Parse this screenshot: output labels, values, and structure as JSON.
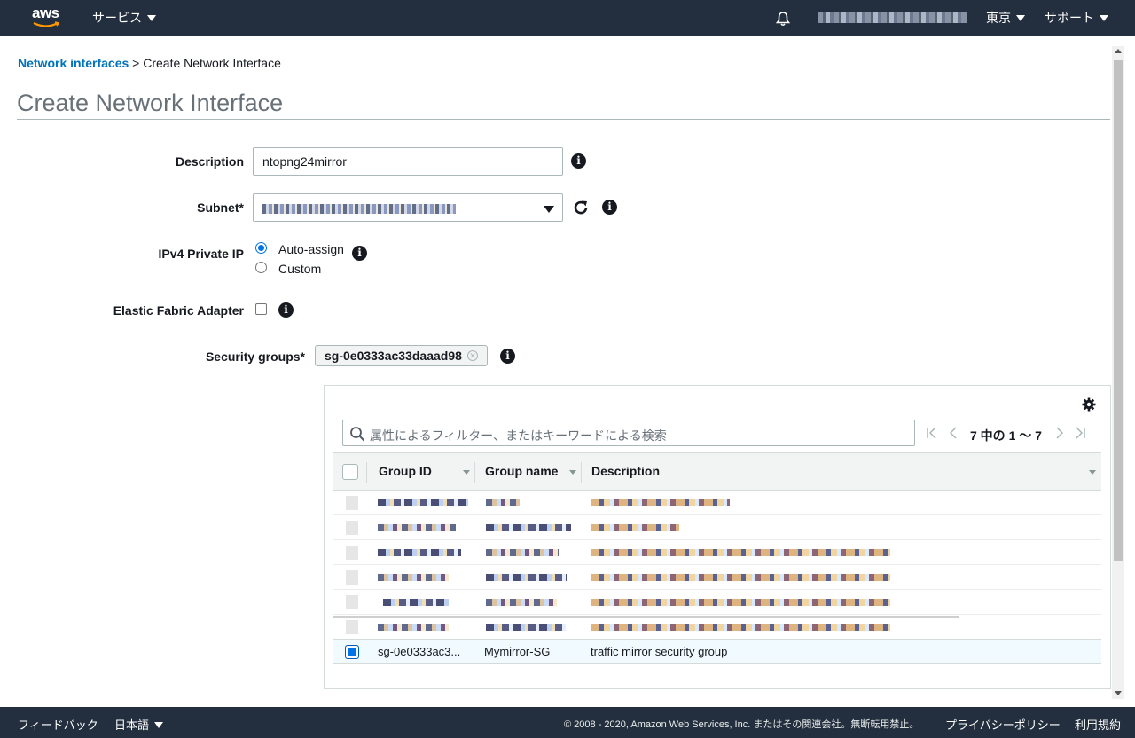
{
  "nav": {
    "logo_text": "aws",
    "services": "サービス",
    "region": "東京",
    "support": "サポート",
    "notifications_icon": "bell-icon"
  },
  "breadcrumb": {
    "parent": "Network interfaces",
    "separator": ">",
    "current": "Create Network Interface"
  },
  "page_title": "Create Network Interface",
  "form": {
    "description_label": "Description",
    "description_value": "ntopng24mirror",
    "subnet_label": "Subnet*",
    "ipv4_label": "IPv4 Private IP",
    "ipv4_options": [
      "Auto-assign",
      "Custom"
    ],
    "ipv4_selected": "Auto-assign",
    "efa_label": "Elastic Fabric Adapter",
    "sg_label": "Security groups*",
    "sg_token": "sg-0e0333ac33daaad98"
  },
  "table": {
    "filter_placeholder": "属性によるフィルター、またはキーワードによる検索",
    "pagination": "7 中の 1 ～ 7",
    "columns": [
      "Group ID",
      "Group name",
      "Description"
    ],
    "selected_row": {
      "group_id": "sg-0e0333ac3...",
      "group_name": "Mymirror-SG",
      "description": "traffic mirror security group"
    }
  },
  "footer": {
    "feedback": "フィードバック",
    "language": "日本語",
    "copyright": "© 2008 - 2020, Amazon Web Services, Inc. またはその関連会社。無断転用禁止。",
    "privacy": "プライバシーポリシー",
    "terms": "利用規約"
  },
  "colors": {
    "nav_bg": "#232f3e",
    "link": "#0073bb",
    "accent": "#0073e6"
  }
}
